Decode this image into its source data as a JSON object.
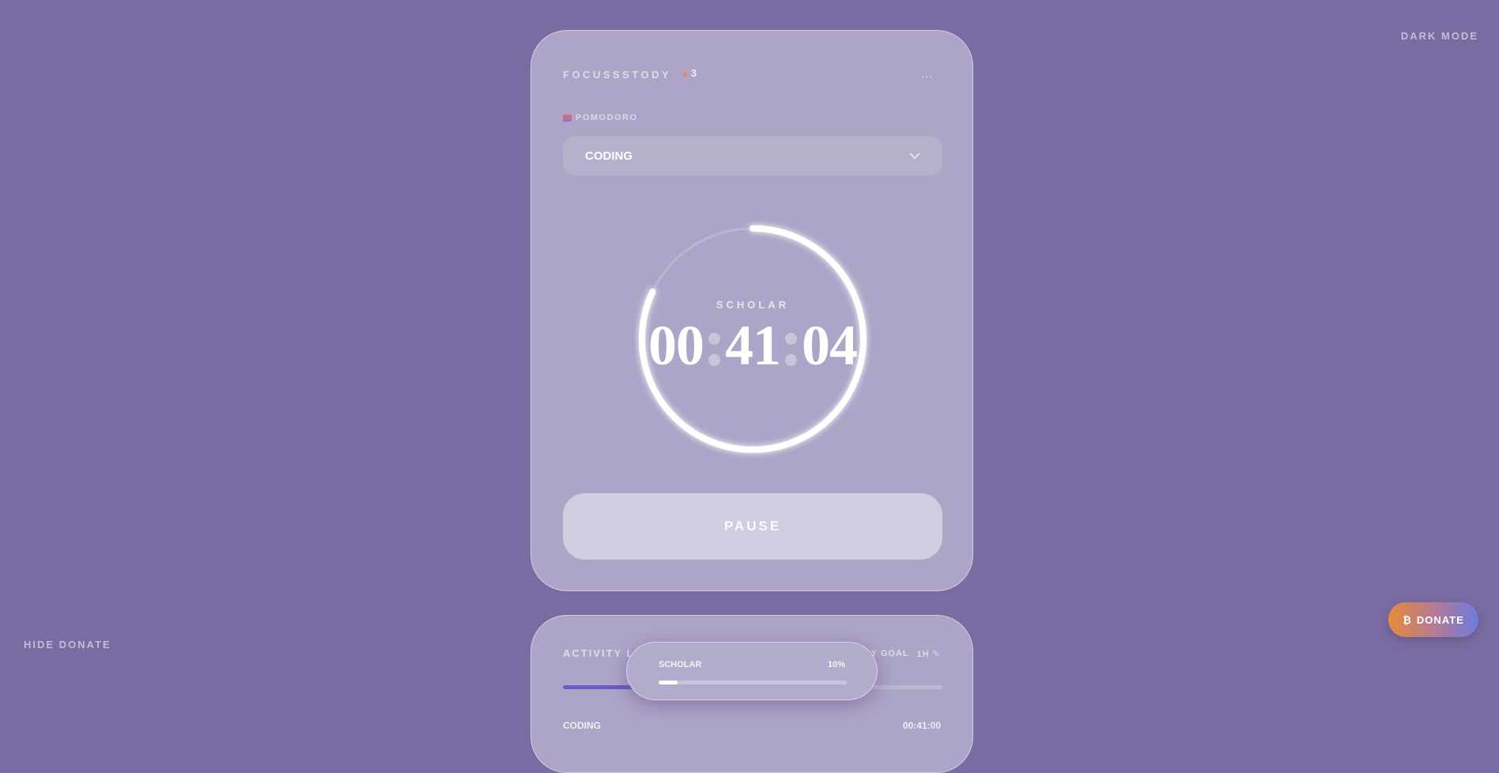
{
  "header": {
    "dark_mode_label": "DARK MODE"
  },
  "brand": {
    "name": "FOCUSSSTODY",
    "streak_count": "3",
    "menu_label": "..."
  },
  "timer": {
    "mode_label": "POMODORO",
    "task_select": {
      "selected": "CODING"
    },
    "rank": "SCHOLAR",
    "hours": "00",
    "minutes": "41",
    "seconds": "04",
    "progress_fraction": 0.82
  },
  "controls": {
    "pause_label": "PAUSE"
  },
  "activity_log": {
    "title": "ACTIVITY LO",
    "goal_label": "Y GOAL",
    "goal_value": "1H",
    "goal_progress_fraction": 0.68,
    "entries": [
      {
        "task": "CODING",
        "duration": "00:41:00"
      }
    ]
  },
  "level_popup": {
    "rank": "SCHOLAR",
    "percent_label": "10%",
    "progress_fraction": 0.1
  },
  "donate": {
    "hide_label": "HIDE DONATE",
    "button_label": "DONATE",
    "icon": "bitcoin-icon"
  },
  "colors": {
    "background": "#7a6ca2",
    "card": "#ada5c7",
    "goal_bar": "#6a5cc4"
  }
}
